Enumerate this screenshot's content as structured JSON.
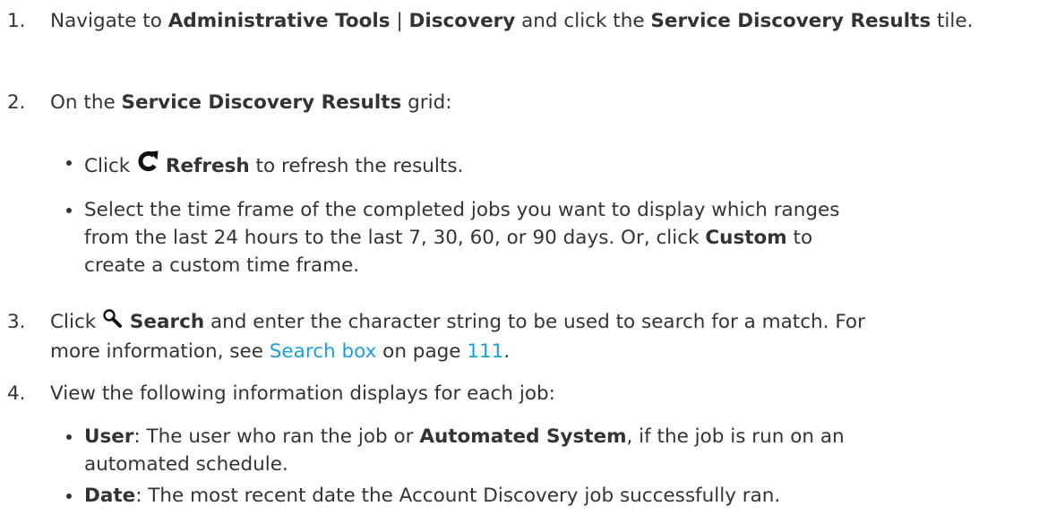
{
  "steps": [
    {
      "number": "1.",
      "t1": "Navigate to ",
      "b1": "Administrative Tools",
      "t2": " | ",
      "b2": "Discovery",
      "t3": " and click the ",
      "b3": "Service Discovery Results",
      "t4": " tile."
    },
    {
      "number": "2.",
      "t1": "On the ",
      "b1": "Service Discovery Results",
      "t2": " grid:",
      "bullets": [
        {
          "t1": "Click ",
          "icon": "refresh-icon",
          "b1": "Refresh",
          "t2": " to refresh the results."
        },
        {
          "line1": "Select the time frame of the completed jobs you want to display which ranges",
          "line2a": "from the last 24 hours to the last 7, 30, 60, or 90 days. Or, click ",
          "b1": "Custom",
          "line2b": " to",
          "line3": "create a custom time frame."
        }
      ]
    },
    {
      "number": "3.",
      "t1": "Click ",
      "icon": "search-icon",
      "b1": "Search",
      "t2": " and enter the character string to be used to search for a match. For",
      "t3": "more information, see ",
      "link": "Search box",
      "t4": " on page ",
      "page": "111",
      "t5": "."
    },
    {
      "number": "4.",
      "t1": "View the following information displays for each job:",
      "bullets": [
        {
          "b1": "User",
          "t1": ": The user who ran the job or ",
          "b2": "Automated System",
          "t2": ", if the job is run on an",
          "line2": "automated schedule."
        },
        {
          "b1": "Date",
          "t1": ": The most recent date the Account Discovery job successfully ran."
        }
      ]
    }
  ],
  "colors": {
    "text": "#333333",
    "link": "#1ba1d9"
  }
}
